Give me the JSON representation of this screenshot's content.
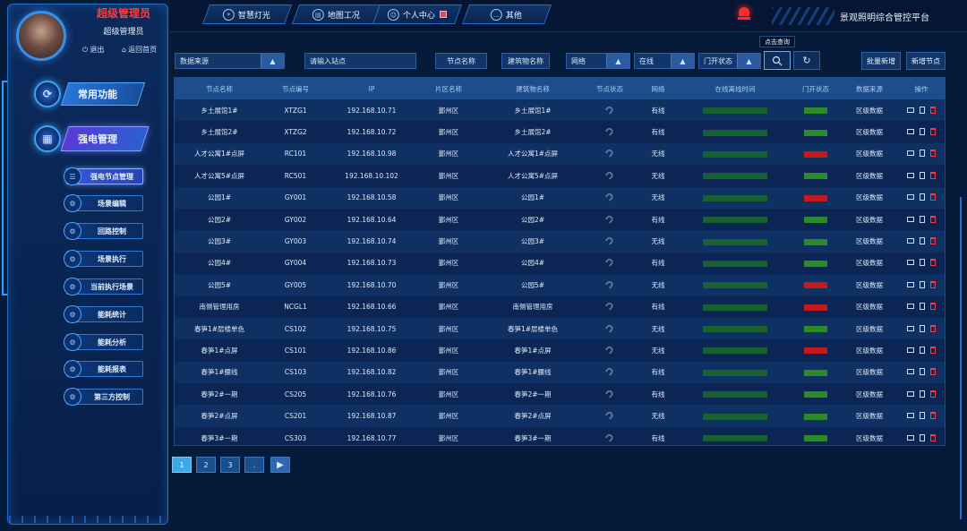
{
  "app": {
    "platform_title": "景观照明综合管控平台"
  },
  "user": {
    "role_title": "超级管理员",
    "role_name": "超级管理员",
    "logout": "退出",
    "home": "返回首页"
  },
  "nav": {
    "tabs": [
      {
        "label": "智慧灯光",
        "icon": "location-pin-icon"
      },
      {
        "label": "地图工况",
        "icon": "map-icon"
      },
      {
        "label": "个人中心",
        "icon": "user-icon"
      },
      {
        "label": "其他",
        "icon": "more-icon"
      }
    ]
  },
  "sidebar": {
    "sections": [
      {
        "label": "常用功能",
        "icon": "refresh-gear-icon"
      },
      {
        "label": "强电管理",
        "icon": "grid-icon",
        "active": true
      }
    ],
    "items": [
      {
        "label": "强电节点管理",
        "active": true
      },
      {
        "label": "场景编辑"
      },
      {
        "label": "回路控制"
      },
      {
        "label": "场景执行"
      },
      {
        "label": "当前执行场景"
      },
      {
        "label": "能耗统计"
      },
      {
        "label": "能耗分析"
      },
      {
        "label": "能耗报表"
      },
      {
        "label": "第三方控制"
      }
    ]
  },
  "filters": {
    "data_source": "数据来源",
    "site_input": "请输入站点",
    "node_name": "节点名称",
    "building_name": "建筑物名称",
    "network": "网络",
    "online": "在线",
    "door_status": "门开状态",
    "search_tooltip": "点击查询",
    "batch_add": "批量新增",
    "add_node": "新增节点"
  },
  "table": {
    "columns": [
      "节点名称",
      "节点编号",
      "IP",
      "片区名称",
      "建筑物名称",
      "节点状态",
      "网络",
      "在线离线时间",
      "门开状态",
      "数据来源",
      "操作"
    ],
    "rows": [
      {
        "name": "乡土展馆1#",
        "code": "XTZG1",
        "ip": "192.168.10.71",
        "area": "鄞州区",
        "building": "乡土展馆1#",
        "net": "有线",
        "door": "green",
        "source": "区级数据"
      },
      {
        "name": "乡土展馆2#",
        "code": "XTZG2",
        "ip": "192.168.10.72",
        "area": "鄞州区",
        "building": "乡土展馆2#",
        "net": "有线",
        "door": "green",
        "source": "区级数据"
      },
      {
        "name": "人才公寓1#点屏",
        "code": "RC101",
        "ip": "192.168.10.98",
        "area": "鄞州区",
        "building": "人才公寓1#点屏",
        "net": "无线",
        "door": "red",
        "source": "区级数据"
      },
      {
        "name": "人才公寓5#点屏",
        "code": "RC501",
        "ip": "192.168.10.102",
        "area": "鄞州区",
        "building": "人才公寓5#点屏",
        "net": "无线",
        "door": "green",
        "source": "区级数据"
      },
      {
        "name": "公园1#",
        "code": "GY001",
        "ip": "192.168.10.58",
        "area": "鄞州区",
        "building": "公园1#",
        "net": "无线",
        "door": "red",
        "source": "区级数据"
      },
      {
        "name": "公园2#",
        "code": "GY002",
        "ip": "192.168.10.64",
        "area": "鄞州区",
        "building": "公园2#",
        "net": "有线",
        "door": "green",
        "source": "区级数据"
      },
      {
        "name": "公园3#",
        "code": "GY003",
        "ip": "192.168.10.74",
        "area": "鄞州区",
        "building": "公园3#",
        "net": "无线",
        "door": "green",
        "source": "区级数据"
      },
      {
        "name": "公园4#",
        "code": "GY004",
        "ip": "192.168.10.73",
        "area": "鄞州区",
        "building": "公园4#",
        "net": "有线",
        "door": "green",
        "source": "区级数据"
      },
      {
        "name": "公园5#",
        "code": "GY005",
        "ip": "192.168.10.70",
        "area": "鄞州区",
        "building": "公园5#",
        "net": "无线",
        "door": "red",
        "source": "区级数据"
      },
      {
        "name": "南侧管理用房",
        "code": "NCGL1",
        "ip": "192.168.10.66",
        "area": "鄞州区",
        "building": "南侧管理用房",
        "net": "有线",
        "door": "red",
        "source": "区级数据"
      },
      {
        "name": "春笋1#层楼单色",
        "code": "CS102",
        "ip": "192.168.10.75",
        "area": "鄞州区",
        "building": "春笋1#层楼单色",
        "net": "无线",
        "door": "green",
        "source": "区级数据"
      },
      {
        "name": "春笋1#点屏",
        "code": "CS101",
        "ip": "192.168.10.86",
        "area": "鄞州区",
        "building": "春笋1#点屏",
        "net": "无线",
        "door": "red",
        "source": "区级数据"
      },
      {
        "name": "春笋1#腰线",
        "code": "CS103",
        "ip": "192.168.10.82",
        "area": "鄞州区",
        "building": "春笋1#腰线",
        "net": "有线",
        "door": "green",
        "source": "区级数据"
      },
      {
        "name": "春笋2#一期",
        "code": "CS205",
        "ip": "192.168.10.76",
        "area": "鄞州区",
        "building": "春笋2#一期",
        "net": "有线",
        "door": "green",
        "source": "区级数据"
      },
      {
        "name": "春笋2#点屏",
        "code": "CS201",
        "ip": "192.168.10.87",
        "area": "鄞州区",
        "building": "春笋2#点屏",
        "net": "无线",
        "door": "green",
        "source": "区级数据"
      },
      {
        "name": "春笋3#一期",
        "code": "CS303",
        "ip": "192.168.10.77",
        "area": "鄞州区",
        "building": "春笋3#一期",
        "net": "有线",
        "door": "green",
        "source": "区级数据"
      }
    ]
  },
  "pagination": {
    "pages": [
      "1",
      "2",
      "3",
      "."
    ],
    "current": "1"
  },
  "colors": {
    "accent": "#3fa8e6",
    "alarm": "#ff2a2a",
    "door_open": "#c41a1a",
    "door_closed": "#2d8a2a",
    "role_title": "#ff3b3b"
  }
}
